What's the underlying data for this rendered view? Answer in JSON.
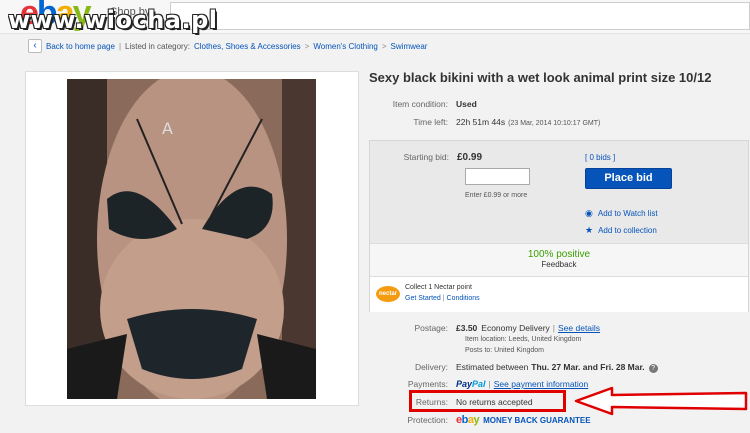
{
  "watermark": "www.wiocha.pl",
  "header": {
    "logo_e": "e",
    "logo_b": "b",
    "logo_a": "a",
    "logo_y": "y",
    "shop_by": "Shop by"
  },
  "breadcrumb": {
    "back_label": "Back to home page",
    "listed_in": "Listed in category:",
    "items": [
      "Clothes, Shoes & Accessories",
      "Women's Clothing",
      "Swimwear"
    ]
  },
  "listing": {
    "title": "Sexy black bikini with a wet look animal print size 10/12",
    "condition_label": "Item condition:",
    "condition_value": "Used",
    "time_left_label": "Time left:",
    "time_left_value": "22h 51m 44s",
    "time_left_date": "(23 Mar, 2014   10:10:17 GMT)"
  },
  "bid": {
    "starting_bid_label": "Starting bid:",
    "starting_bid_value": "£0.99",
    "bids_count": "[ 0 bids ]",
    "input_hint": "Enter £0.99 or more",
    "place_bid_label": "Place bid",
    "watch_list_label": "Add to Watch list",
    "collection_label": "Add to collection"
  },
  "seller": {
    "positive": "100% positive",
    "feedback_label": "Feedback"
  },
  "nectar": {
    "logo": "nectar",
    "collect_text": "Collect 1 Nectar point",
    "get_started": "Get Started",
    "conditions": "Conditions"
  },
  "postage": {
    "label": "Postage:",
    "price": "£3.50",
    "service": "Economy Delivery",
    "see_details": "See details",
    "item_location": "Item location:  Leeds, United Kingdom",
    "posts_to": "Posts to:  United Kingdom"
  },
  "delivery": {
    "label": "Delivery:",
    "value_prefix": "Estimated between",
    "value_range": "Thu. 27 Mar. and Fri. 28 Mar."
  },
  "payments": {
    "label": "Payments:",
    "paypal_1": "Pay",
    "paypal_2": "Pal",
    "see_info": "See payment information"
  },
  "returns": {
    "label": "Returns:",
    "value": "No returns accepted"
  },
  "protection": {
    "label": "Protection:",
    "ebay_e": "e",
    "ebay_b": "b",
    "ebay_a": "a",
    "ebay_y": "y",
    "guarantee": "MONEY BACK GUARANTEE"
  },
  "colors": {
    "link": "#0654ba",
    "button": "#0654ba",
    "positive": "#3a9f00",
    "annotation": "#e00000"
  }
}
